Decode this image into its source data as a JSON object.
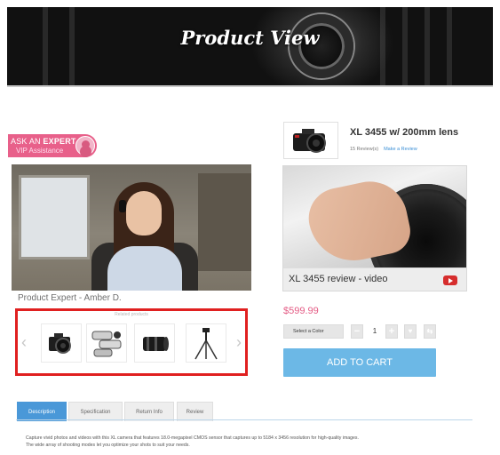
{
  "banner": {
    "title": "Product View"
  },
  "expert": {
    "badge_prefix": "ASK AN ",
    "badge_strong": "EXPERT",
    "badge_sub": "VIP Assistance",
    "name": "Product Expert - Amber D."
  },
  "related": {
    "caption": "Related products",
    "prev_icon": "‹",
    "next_icon": "›",
    "items": [
      {
        "icon": "dslr-camera-icon"
      },
      {
        "icon": "lens-set-icon"
      },
      {
        "icon": "telephoto-lens-icon"
      },
      {
        "icon": "tripod-icon"
      }
    ]
  },
  "product": {
    "title": "XL 3455 w/ 200mm lens",
    "reviews": "15 Review(s)",
    "make_review": "Make a Review",
    "video_label": "XL 3455 review - video",
    "price": "$599.99",
    "select_color": "Select a Color",
    "qty_minus": "−",
    "quantity": "1",
    "qty_plus": "+",
    "wishlist_icon": "♥",
    "compare_icon": "⇆",
    "add_to_cart": "ADD TO CART"
  },
  "tabs": [
    {
      "label": "Description"
    },
    {
      "label": "Specification"
    },
    {
      "label": "Return Info"
    },
    {
      "label": "Review"
    }
  ],
  "description": {
    "line1": "Capture vivid photos and videos with this XL camera that features 18.0-megapixel CMOS sensor that captures up to 5184 x 3456 resolution for high-quality images.",
    "line2": "The wide array of shooting modes let you optimize your shots to suit your needs."
  },
  "colors": {
    "accent_pink": "#e45c85",
    "tab_active": "#4a98d8",
    "cart_button": "#6cb8e6",
    "highlight_border": "#e02020"
  }
}
